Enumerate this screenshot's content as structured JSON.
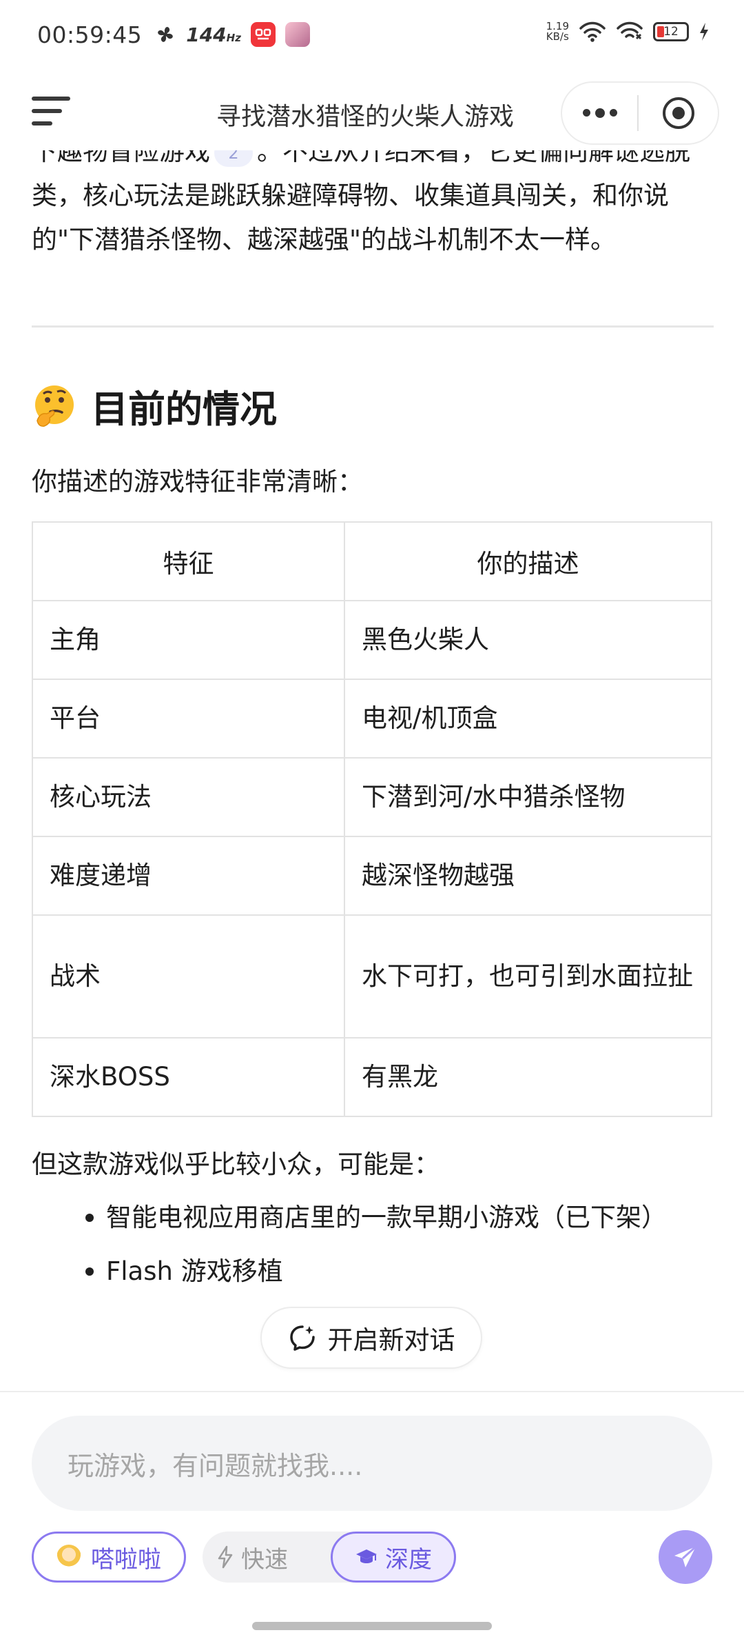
{
  "status_bar": {
    "time": "00:59:45",
    "refresh_rate": "144",
    "refresh_unit": "Hz",
    "net_speed_value": "1.19",
    "net_speed_unit": "KB/s",
    "battery": "12",
    "battery_color": "#e53935"
  },
  "header": {
    "title": "寻找潜水猎怪的火柴人游戏"
  },
  "article": {
    "partial_paragraph_line1_a": "下趣物冒险游戏",
    "citation": "2",
    "partial_paragraph_line1_b": "。不过从介绍来看，它更偏向解谜",
    "partial_paragraph_rest": "逃脱类，核心玩法是跳跃躲避障碍物、收集道具闯关，和你说的\"下潜猎杀怪物、越深越强\"的战斗机制不太一样。",
    "section_title": "目前的情况",
    "section_emoji": "thinking-face-icon",
    "intro": "你描述的游戏特征非常清晰：",
    "table": {
      "headers": [
        "特征",
        "你的描述"
      ],
      "rows": [
        [
          "主角",
          "黑色火柴人"
        ],
        [
          "平台",
          "电视/机顶盒"
        ],
        [
          "核心玩法",
          "下潜到河/水中猎杀怪物"
        ],
        [
          "难度递增",
          "越深怪物越强"
        ],
        [
          "战术",
          "水下可打，也可引到水面拉扯"
        ],
        [
          "深水BOSS",
          "有黑龙"
        ]
      ]
    },
    "after_table": "但这款游戏似乎比较小众，可能是：",
    "options": [
      "智能电视应用商店里的一款早期小游戏（已下架）",
      "Flash 游戏移植"
    ]
  },
  "new_chat": {
    "label": "开启新对话"
  },
  "composer": {
    "placeholder": "玩游戏，有问题就找我....",
    "agent_label": "嗒啦啦",
    "mode_fast": "快速",
    "mode_deep": "深度",
    "accent_color": "#8c7af0",
    "send_color": "#a99bf5"
  }
}
